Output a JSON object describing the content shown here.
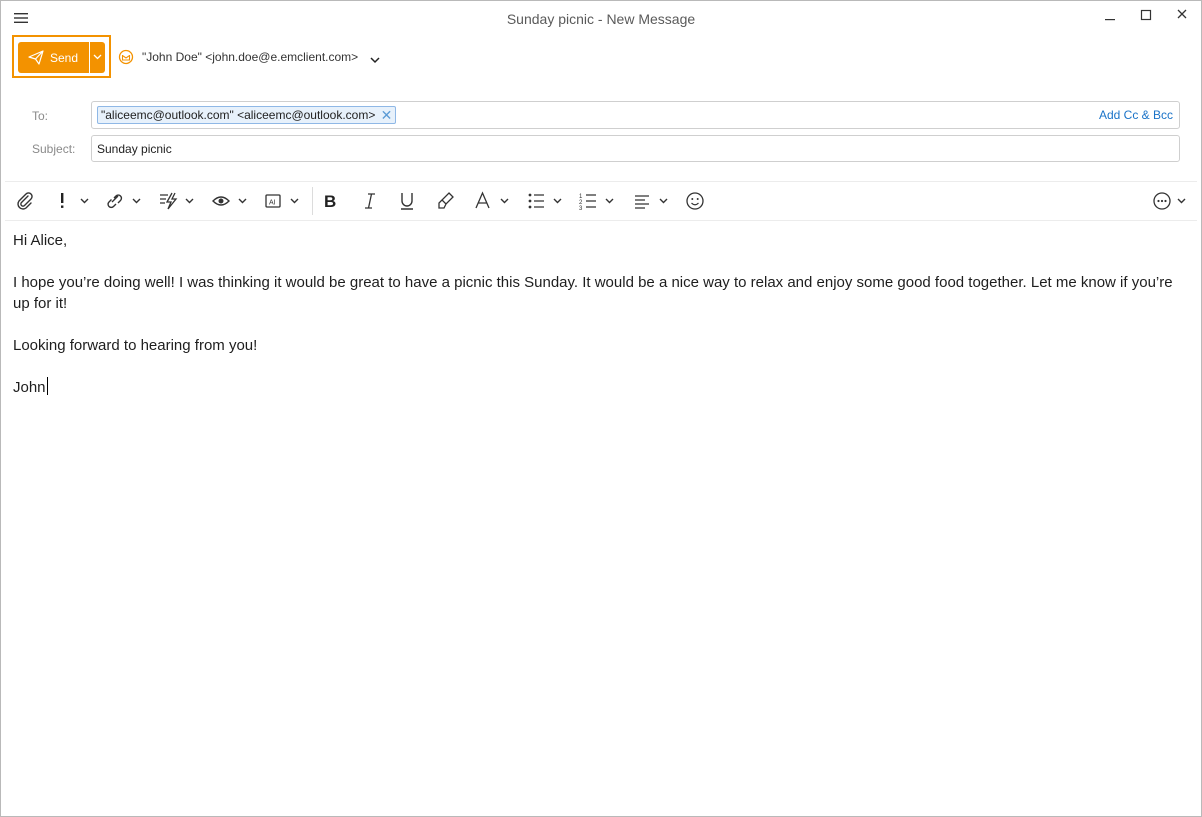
{
  "window": {
    "title": "Sunday picnic - New Message",
    "controls": [
      "minimize-icon",
      "maximize-icon",
      "close-icon"
    ]
  },
  "toolbar_top": {
    "send_label": "Send",
    "from": "\"John Doe\" <john.doe@e.emclient.com>"
  },
  "fields": {
    "to_label": "To:",
    "to_recipient": "\"aliceemc@outlook.com\" <aliceemc@outlook.com>",
    "add_cc_bcc": "Add Cc & Bcc",
    "subject_label": "Subject:",
    "subject_value": "Sunday picnic"
  },
  "format_toolbar": {
    "icons": [
      "paperclip-icon",
      "importance-icon",
      "link-icon",
      "quick-text-icon",
      "eye-icon",
      "template-icon",
      "bold-icon",
      "italic-icon",
      "underline-icon",
      "format-painter-icon",
      "font-icon",
      "bullet-list-icon",
      "numbered-list-icon",
      "align-icon",
      "emoji-icon",
      "more-icon"
    ]
  },
  "message": {
    "greeting": "Hi Alice,",
    "paragraph": "I hope you’re doing well! I was thinking it would be great to have a picnic this Sunday. It would be a nice way to relax and enjoy some good food together. Let me know if you’re up for it!",
    "closing": "Looking forward to hearing from you!",
    "signature": "John"
  },
  "colors": {
    "accent": "#f39200",
    "link": "#1a73c8",
    "chip_border": "#8fb8e6",
    "chip_bg": "#e7f1fb"
  }
}
